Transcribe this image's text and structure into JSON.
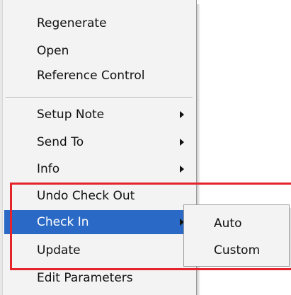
{
  "context_menu": {
    "items": [
      {
        "label": "Regenerate",
        "has_submenu": false
      },
      {
        "label": "Open",
        "has_submenu": false
      },
      {
        "label": "Reference Control",
        "has_submenu": false
      },
      {
        "label": "Setup Note",
        "has_submenu": true
      },
      {
        "label": "Send To",
        "has_submenu": true
      },
      {
        "label": "Info",
        "has_submenu": true
      },
      {
        "label": "Undo Check Out",
        "has_submenu": false
      },
      {
        "label": "Check In",
        "has_submenu": true,
        "highlighted": true
      },
      {
        "label": "Update",
        "has_submenu": false
      },
      {
        "label": "Edit Parameters",
        "has_submenu": false
      }
    ]
  },
  "submenu_check_in": {
    "items": [
      {
        "label": "Auto"
      },
      {
        "label": "Custom"
      }
    ]
  },
  "colors": {
    "highlight": "#2a6ac6",
    "callout_border": "#e4232b",
    "menu_background": "#f3f3f3"
  }
}
